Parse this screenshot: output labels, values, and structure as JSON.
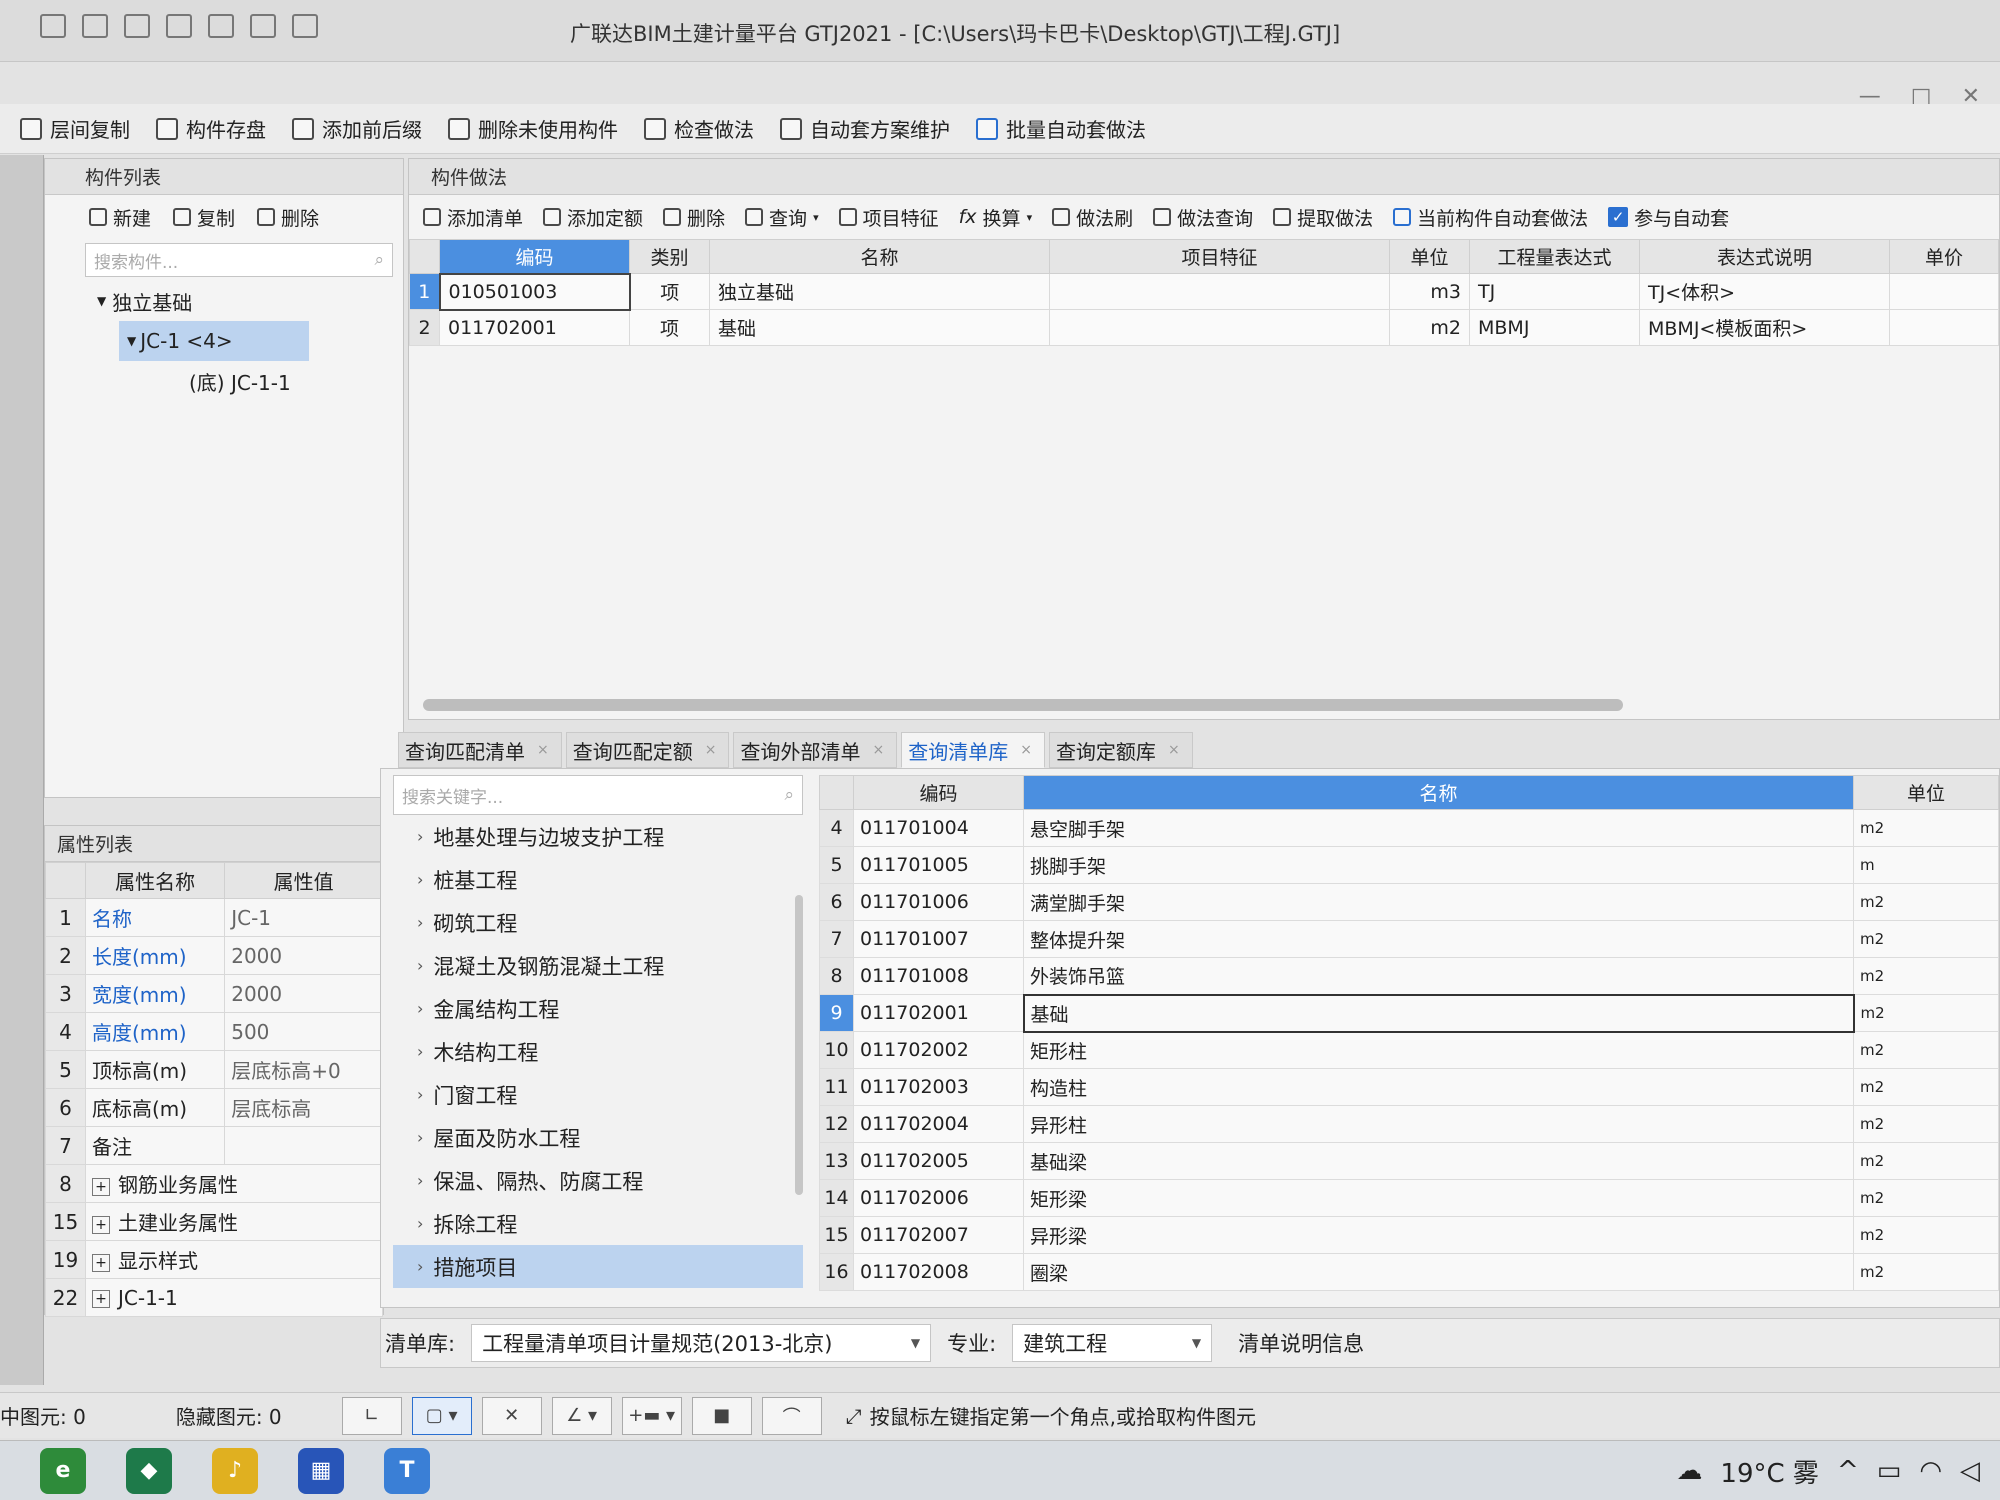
{
  "window": {
    "title": "广联达BIM土建计量平台 GTJ2021 - [C:\\Users\\玛卡巴卡\\Desktop\\GTJ\\工程J.GTJ]",
    "controls": [
      "—",
      "□",
      "✕"
    ]
  },
  "toolbar": {
    "items": [
      "层间复制",
      "构件存盘",
      "添加前后缀",
      "删除未使用构件",
      "检查做法",
      "自动套方案维护",
      "批量自动套做法"
    ]
  },
  "component_list": {
    "title": "构件列表",
    "tools": [
      "新建",
      "复制",
      "删除"
    ],
    "search_placeholder": "搜索构件...",
    "tree": {
      "group": "独立基础",
      "item": "JC-1 <4>",
      "child": "(底) JC-1-1"
    }
  },
  "property_list": {
    "title": "属性列表",
    "col_name": "属性名称",
    "col_value": "属性值",
    "rows": [
      {
        "n": "1",
        "name": "名称",
        "value": "JC-1"
      },
      {
        "n": "2",
        "name": "长度(mm)",
        "value": "2000"
      },
      {
        "n": "3",
        "name": "宽度(mm)",
        "value": "2000"
      },
      {
        "n": "4",
        "name": "高度(mm)",
        "value": "500"
      },
      {
        "n": "5",
        "name": "顶标高(m)",
        "value": "层底标高+0"
      },
      {
        "n": "6",
        "name": "底标高(m)",
        "value": "层底标高"
      },
      {
        "n": "7",
        "name": "备注",
        "value": ""
      },
      {
        "n": "8",
        "name": "钢筋业务属性",
        "value": ""
      },
      {
        "n": "15",
        "name": "土建业务属性",
        "value": ""
      },
      {
        "n": "19",
        "name": "显示样式",
        "value": ""
      },
      {
        "n": "22",
        "name": "JC-1-1",
        "value": ""
      }
    ]
  },
  "method": {
    "title": "构件做法",
    "tools": [
      "添加清单",
      "添加定额",
      "删除",
      "查询",
      "项目特征",
      "换算",
      "做法刷",
      "做法查询",
      "提取做法",
      "当前构件自动套做法",
      "参与自动套"
    ],
    "headers": [
      "编码",
      "类别",
      "名称",
      "项目特征",
      "单位",
      "工程量表达式",
      "表达式说明",
      "单价"
    ],
    "rows": [
      {
        "n": "1",
        "code": "010501003",
        "type": "项",
        "name": "独立基础",
        "feature": "",
        "unit": "m3",
        "expr": "TJ",
        "desc": "TJ<体积>",
        "price": ""
      },
      {
        "n": "2",
        "code": "011702001",
        "type": "项",
        "name": "基础",
        "feature": "",
        "unit": "m2",
        "expr": "MBMJ",
        "desc": "MBMJ<模板面积>",
        "price": ""
      }
    ]
  },
  "query_tabs": [
    "查询匹配清单",
    "查询匹配定额",
    "查询外部清单",
    "查询清单库",
    "查询定额库"
  ],
  "library": {
    "search_placeholder": "搜索关键字...",
    "categories": [
      "地基处理与边坡支护工程",
      "桩基工程",
      "砌筑工程",
      "混凝土及钢筋混凝土工程",
      "金属结构工程",
      "木结构工程",
      "门窗工程",
      "屋面及防水工程",
      "保温、隔热、防腐工程",
      "拆除工程",
      "措施项目"
    ],
    "headers": [
      "编码",
      "名称",
      "单位"
    ],
    "rows": [
      {
        "n": "4",
        "code": "011701004",
        "name": "悬空脚手架",
        "unit": "m2"
      },
      {
        "n": "5",
        "code": "011701005",
        "name": "挑脚手架",
        "unit": "m"
      },
      {
        "n": "6",
        "code": "011701006",
        "name": "满堂脚手架",
        "unit": "m2"
      },
      {
        "n": "7",
        "code": "011701007",
        "name": "整体提升架",
        "unit": "m2"
      },
      {
        "n": "8",
        "code": "011701008",
        "name": "外装饰吊篮",
        "unit": "m2"
      },
      {
        "n": "9",
        "code": "011702001",
        "name": "基础",
        "unit": "m2"
      },
      {
        "n": "10",
        "code": "011702002",
        "name": "矩形柱",
        "unit": "m2"
      },
      {
        "n": "11",
        "code": "011702003",
        "name": "构造柱",
        "unit": "m2"
      },
      {
        "n": "12",
        "code": "011702004",
        "name": "异形柱",
        "unit": "m2"
      },
      {
        "n": "13",
        "code": "011702005",
        "name": "基础梁",
        "unit": "m2"
      },
      {
        "n": "14",
        "code": "011702006",
        "name": "矩形梁",
        "unit": "m2"
      },
      {
        "n": "15",
        "code": "011702007",
        "name": "异形梁",
        "unit": "m2"
      },
      {
        "n": "16",
        "code": "011702008",
        "name": "圈梁",
        "unit": "m2"
      }
    ]
  },
  "footer": {
    "lib_label": "清单库:",
    "lib_value": "工程量清单项目计量规范(2013-北京)",
    "major_label": "专业:",
    "major_value": "建筑工程",
    "info": "清单说明信息"
  },
  "status": {
    "selected": "中图元: 0",
    "hidden": "隐藏图元: 0",
    "hint": "按鼠标左键指定第一个角点,或拾取构件图元"
  },
  "taskbar": {
    "weather": "19°C 雾"
  }
}
